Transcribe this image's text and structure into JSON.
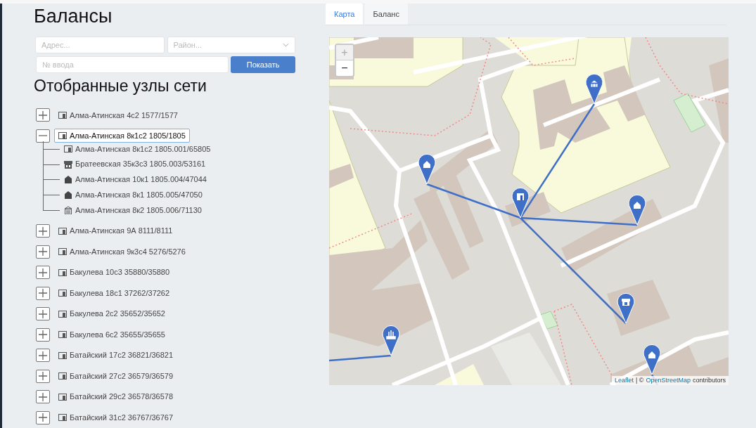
{
  "title": "Балансы",
  "filters": {
    "address": {
      "placeholder": "Адрес..."
    },
    "district": {
      "placeholder": "Район..."
    },
    "entry": {
      "placeholder": "№ ввода"
    },
    "button": "Показать"
  },
  "section_title": "Отобранные узлы сети",
  "tree": [
    {
      "label": "Алма-Атинская 4с2 1577/1577",
      "kind": "node",
      "expanded": false,
      "selected": false
    },
    {
      "label": "Алма-Атинская 8к1с2 1805/1805",
      "kind": "node",
      "expanded": true,
      "selected": true,
      "children": [
        {
          "label": "Алма-Атинская 8к1с2 1805.001/65805",
          "kind": "node"
        },
        {
          "label": "Братеевская 35к3с3 1805.003/53161",
          "kind": "shop"
        },
        {
          "label": "Алма-Атинская 10к1 1805.004/47044",
          "kind": "house"
        },
        {
          "label": "Алма-Атинская 8к1 1805.005/47050",
          "kind": "house"
        },
        {
          "label": "Алма-Атинская 8к2 1805.006/71130",
          "kind": "school"
        }
      ]
    },
    {
      "label": "Алма-Атинская 9А 8111/8111",
      "kind": "node",
      "expanded": false,
      "selected": false
    },
    {
      "label": "Алма-Атинская 9к3с4 5276/5276",
      "kind": "node",
      "expanded": false,
      "selected": false
    },
    {
      "label": "Бакулева 10с3 35880/35880",
      "kind": "node",
      "expanded": false,
      "selected": false
    },
    {
      "label": "Бакулева 18с1 37262/37262",
      "kind": "node",
      "expanded": false,
      "selected": false
    },
    {
      "label": "Бакулева 2с2 35652/35652",
      "kind": "node",
      "expanded": false,
      "selected": false
    },
    {
      "label": "Бакулева 6с2 35655/35655",
      "kind": "node",
      "expanded": false,
      "selected": false
    },
    {
      "label": "Батайский 17с2 36821/36821",
      "kind": "node",
      "expanded": false,
      "selected": false
    },
    {
      "label": "Батайский 27с2 36579/36579",
      "kind": "node",
      "expanded": false,
      "selected": false
    },
    {
      "label": "Батайский 29с2 36578/36578",
      "kind": "node",
      "expanded": false,
      "selected": false
    },
    {
      "label": "Батайский 31с2 36767/36767",
      "kind": "node",
      "expanded": false,
      "selected": false
    }
  ],
  "tabs": [
    {
      "label": "Карта",
      "selected": true
    },
    {
      "label": "Баланс",
      "selected": false
    }
  ],
  "map": {
    "zoom_in": "+",
    "zoom_out": "−",
    "attribution": {
      "leaflet": "Leaflet",
      "separator": "| ©",
      "osm": "OpenStreetMap",
      "suffix": "contributors"
    }
  }
}
